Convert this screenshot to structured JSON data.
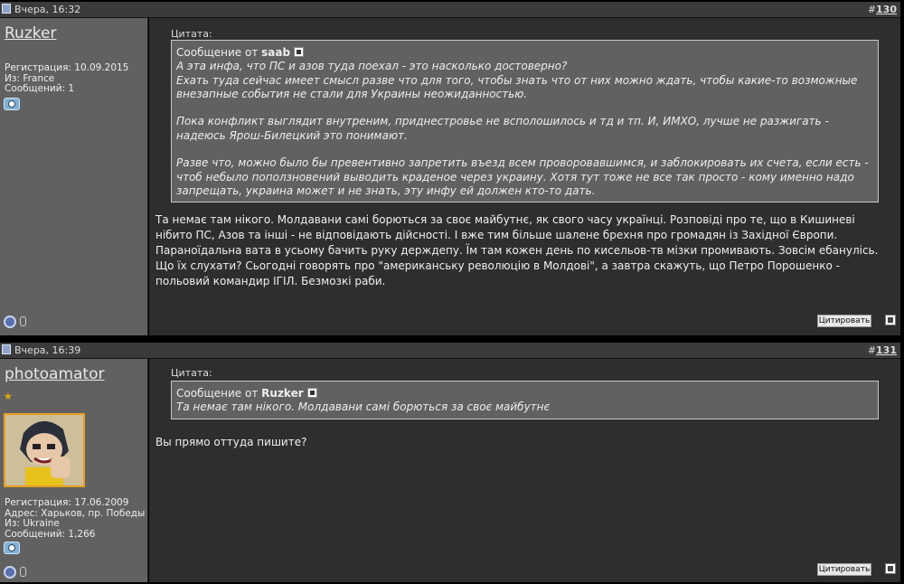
{
  "posts": [
    {
      "date": "Вчера, 16:32",
      "number_prefix": "#",
      "number": "130",
      "user": {
        "name": "Ruzker",
        "reg": "Регистрация: 10.09.2015",
        "from": "Из: France",
        "posts": "Сообщений: 1"
      },
      "quote": {
        "label": "Цитата:",
        "from_prefix": "Сообщение от",
        "author": "saab",
        "text": "А эта инфа, что ПС и азов туда поехал - это насколько достоверно?\nЕхать туда сейчас имеет смысл разве что для того, чтобы знать что от них можно ждать, чтобы какие-то возможные внезапные события не стали для Украины неожиданностью.\n\nПока конфликт выглядит внутреним, приднестровье не всполошилось и тд и тп. И, ИМХО, лучше не разжигать - надеюсь Ярош-Билецкий это понимают.\n\nРазве что, можно было бы превентивно запретить въезд всем проворовавшимся, и заблокировать их счета, если есть - чтоб небыло поползновений выводить краденое через украину. Хотя тут тоже не все так просто - кому именно надо запрещать, украина может и не знать, эту инфу ей должен кто-то дать."
      },
      "message": "Та немає там нікого. Молдавани самі борються за своє майбутнє, як свого часу українці. Розповіді про те, що в Кишиневі нібито ПС, Азов та інші - не відповідають дійсності. І вже тим більше шалене брехня про громадян із Західної Європи. Параноїдальна вата в усьому бачить руку держдепу. Їм там кожен день по кисельов-тв мізки промивають. Зовсім ебанулісь. Що їх слухати? Сьогодні говорять про \"американську революцію в Молдові\", а завтра скажуть, що Петро Порошенко - польовий командир ІГІЛ. Безмозкі раби.",
      "quote_button": "Цитировать"
    },
    {
      "date": "Вчера, 16:39",
      "number_prefix": "#",
      "number": "131",
      "user": {
        "name": "photoamator",
        "reg": "Регистрация: 17.06.2009",
        "address": "Адрес: Харьков, пр. Победы",
        "from": "Из: Ukraine",
        "posts": "Сообщений: 1,266"
      },
      "quote": {
        "label": "Цитата:",
        "from_prefix": "Сообщение от",
        "author": "Ruzker",
        "text": "Та немає там нікого. Молдавани самі борються за своє майбутнє"
      },
      "message": "Вы прямо оттуда пишите?",
      "quote_button": "Цитировать"
    }
  ],
  "icons": {
    "post_icon": "document-icon",
    "profile": "camera-icon",
    "status": "online-status-icon",
    "rank": "star-icon",
    "view_post": "view-post-icon",
    "multiquote": "multiquote-icon"
  }
}
